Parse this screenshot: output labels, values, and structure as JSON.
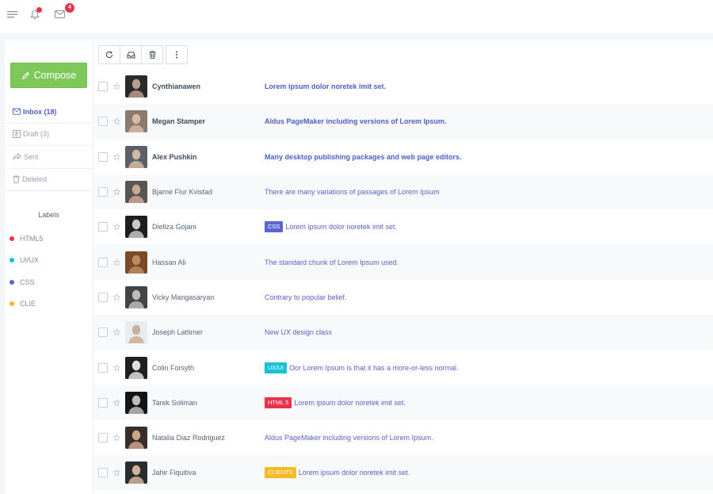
{
  "topbar": {
    "icons": [
      "menu-icon",
      "bell-icon",
      "mail-icon"
    ],
    "mail_badge": "4"
  },
  "sidebar": {
    "compose_label": "Compose",
    "folders": [
      {
        "label": "Inbox (18)",
        "icon": "inbox-icon",
        "active": true
      },
      {
        "label": "Draft (3)",
        "icon": "draft-icon",
        "active": false
      },
      {
        "label": "Sent",
        "icon": "sent-icon",
        "active": false
      },
      {
        "label": "Deleted",
        "icon": "trash-icon",
        "active": false
      }
    ],
    "labels_title": "Labels",
    "labels": [
      {
        "label": "HTML5",
        "color": "#e8334a"
      },
      {
        "label": "UI/UX",
        "color": "#17c2d7"
      },
      {
        "label": "CSS",
        "color": "#5b65d1"
      },
      {
        "label": "CLIE",
        "color": "#f7b924"
      }
    ]
  },
  "toolbar": {
    "icons": [
      "refresh-icon",
      "archive-icon",
      "trash-icon",
      "more-vertical-icon"
    ]
  },
  "tag_colors": {
    "CSS": "#5b65d1",
    "UX/UI": "#17c2d7",
    "HTML 5": "#e8334a",
    "CLIENTS": "#f7b924"
  },
  "emails": [
    {
      "sender": "Cynthianawen",
      "subject": "Lorem ipsum dolor noretek imit set.",
      "tag": "",
      "unread": true
    },
    {
      "sender": "Megan Stamper",
      "subject": "Aldus PageMaker including versions of Lorem Ipsum.",
      "tag": "",
      "unread": true
    },
    {
      "sender": "Alex Pushkin",
      "subject": "Many desktop publishing packages and web page editors.",
      "tag": "",
      "unread": true
    },
    {
      "sender": "Bjarne Flur Kvistad",
      "subject": "There are many variations of passages of Lorem Ipsum",
      "tag": "",
      "unread": false
    },
    {
      "sender": "Diellza Gojani",
      "subject": "Lorem ipsum dolor noretek imit set.",
      "tag": "CSS",
      "unread": false
    },
    {
      "sender": "Hassan Ali",
      "subject": "The standard chunk of Lorem Ipsum used.",
      "tag": "",
      "unread": false
    },
    {
      "sender": "Vicky Mangasaryan",
      "subject": "Contrary to popular belief.",
      "tag": "",
      "unread": false
    },
    {
      "sender": "Joseph Lattimer",
      "subject": "New UX design class",
      "tag": "",
      "unread": false
    },
    {
      "sender": "Colin Forsyth",
      "subject": "Oor Lorem Ipsum is that it has a more-or-less normal.",
      "tag": "UX/UI",
      "unread": false
    },
    {
      "sender": "Tarek Soliman",
      "subject": "Lorem ipsum dolor noretek imit set.",
      "tag": "HTML 5",
      "unread": false
    },
    {
      "sender": "Natalia Diaz Rodriguez",
      "subject": "Aldus PageMaker including versions of Lorem Ipsum.",
      "tag": "",
      "unread": false
    },
    {
      "sender": "Jahir Fiquitiva",
      "subject": "Lorem ipsum dolor noretek imit set.",
      "tag": "CLIENTS",
      "unread": false
    }
  ]
}
